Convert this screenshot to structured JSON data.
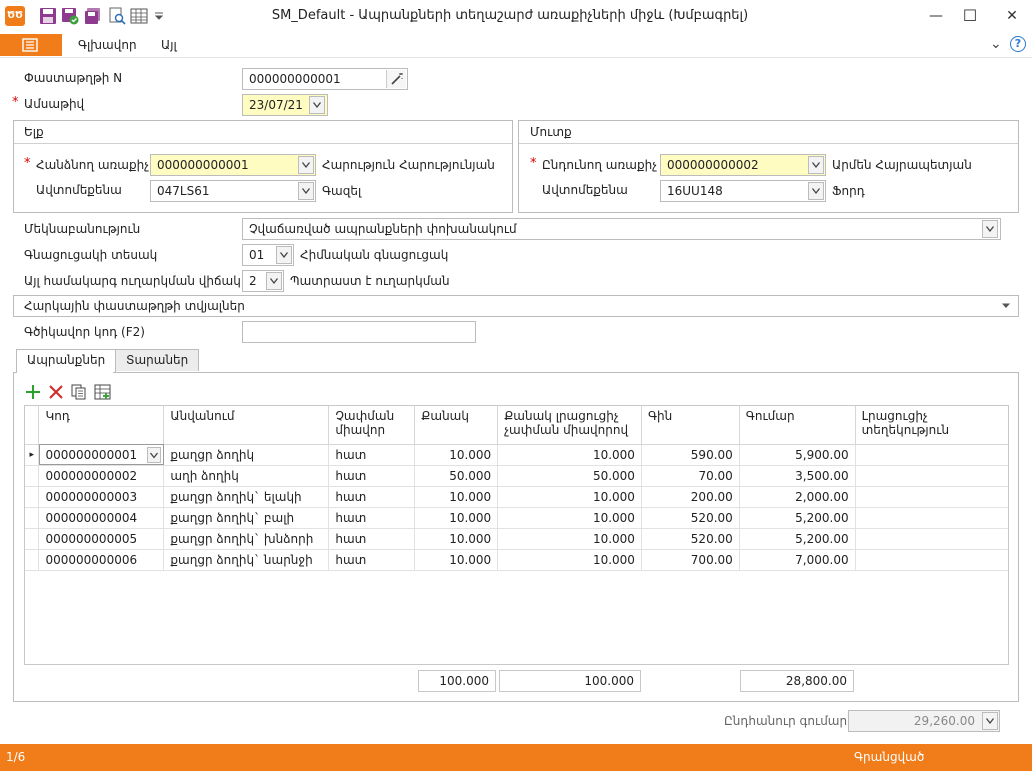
{
  "window": {
    "title": "SM_Default - Ապրանքների տեղաշարժ առաքիչների միջև (Խմբագրել)",
    "logo": "ԾԾ",
    "minimize": "—",
    "maximize": "☐",
    "close": "✕"
  },
  "menu": {
    "items": [
      "Գլխավոր",
      "Այլ"
    ],
    "help_icon": "?",
    "collapse_icon": "⌄"
  },
  "form": {
    "doc_number_label": "Փաստաթղթի N",
    "doc_number_value": "000000000001",
    "date_label": "Ամսաթիվ",
    "date_value": "23/07/21",
    "required_mark": "*"
  },
  "out_group": {
    "title": "Ելք",
    "sender_label": "Հանձնող առաքիչ",
    "sender_value": "000000000001",
    "sender_name": "Հարություն Հարությունյան",
    "car_label": "Ավտոմեքենա",
    "car_value": "047LS61",
    "car_name": "Գազել"
  },
  "in_group": {
    "title": "Մուտք",
    "receiver_label": "Ընդունող առաքիչ",
    "receiver_value": "000000000002",
    "receiver_name": "Արմեն Հայրապետյան",
    "car_label": "Ավտոմեքենա",
    "car_value": "16UU148",
    "car_name": "Ֆորդ"
  },
  "details": {
    "comment_label": "Մեկնաբանություն",
    "comment_value": "Չվաճառված ապրանքների փոխանակում",
    "price_type_label": "Գնացուցակի տեսակ",
    "price_type_value": "01",
    "price_type_name": "Հիմնական գնացուցակ",
    "send_status_label": "Այլ համակարգ ուղարկման վիճակ",
    "send_status_value": "2",
    "send_status_name": "Պատրաստ է ուղարկման",
    "tax_section": "Հարկային փաստաթղթի տվյալներ",
    "barcode_label": "Գծիկավոր կոդ (F2)",
    "barcode_value": ""
  },
  "tabs": [
    "Ապրանքներ",
    "Տարաներ"
  ],
  "grid": {
    "columns": [
      "Կոդ",
      "Անվանում",
      "Չափման միավոր",
      "Քանակ",
      "Քանակ լրացուցիչ չափման միավորով",
      "Գին",
      "Գումար",
      "Լրացուցիչ տեղեկություն"
    ],
    "rows": [
      {
        "code": "000000000001",
        "name": "քաղցր ձողիկ",
        "unit": "հատ",
        "qty": "10.000",
        "qty2": "10.000",
        "price": "590.00",
        "sum": "5,900.00",
        "info": ""
      },
      {
        "code": "000000000002",
        "name": "աղի ձողիկ",
        "unit": "հատ",
        "qty": "50.000",
        "qty2": "50.000",
        "price": "70.00",
        "sum": "3,500.00",
        "info": ""
      },
      {
        "code": "000000000003",
        "name": "քաղցր ձողիկ` ելակի",
        "unit": "հատ",
        "qty": "10.000",
        "qty2": "10.000",
        "price": "200.00",
        "sum": "2,000.00",
        "info": ""
      },
      {
        "code": "000000000004",
        "name": "քաղցր ձողիկ` բալի",
        "unit": "հատ",
        "qty": "10.000",
        "qty2": "10.000",
        "price": "520.00",
        "sum": "5,200.00",
        "info": ""
      },
      {
        "code": "000000000005",
        "name": "քաղցր ձողիկ` խնձորի",
        "unit": "հատ",
        "qty": "10.000",
        "qty2": "10.000",
        "price": "520.00",
        "sum": "5,200.00",
        "info": ""
      },
      {
        "code": "000000000006",
        "name": "քաղցր ձողիկ` նարնջի",
        "unit": "հատ",
        "qty": "10.000",
        "qty2": "10.000",
        "price": "700.00",
        "sum": "7,000.00",
        "info": ""
      }
    ],
    "totals": {
      "qty": "100.000",
      "qty2": "100.000",
      "sum": "28,800.00"
    },
    "row_indicator": "▸"
  },
  "footer": {
    "total_label": "Ընդհանուր գումար",
    "total_value": "29,260.00"
  },
  "status": {
    "page": "1/6",
    "state": "Գրանցված"
  },
  "colors": {
    "accent": "#f07c1a",
    "field_highlight": "#fffcc2"
  }
}
